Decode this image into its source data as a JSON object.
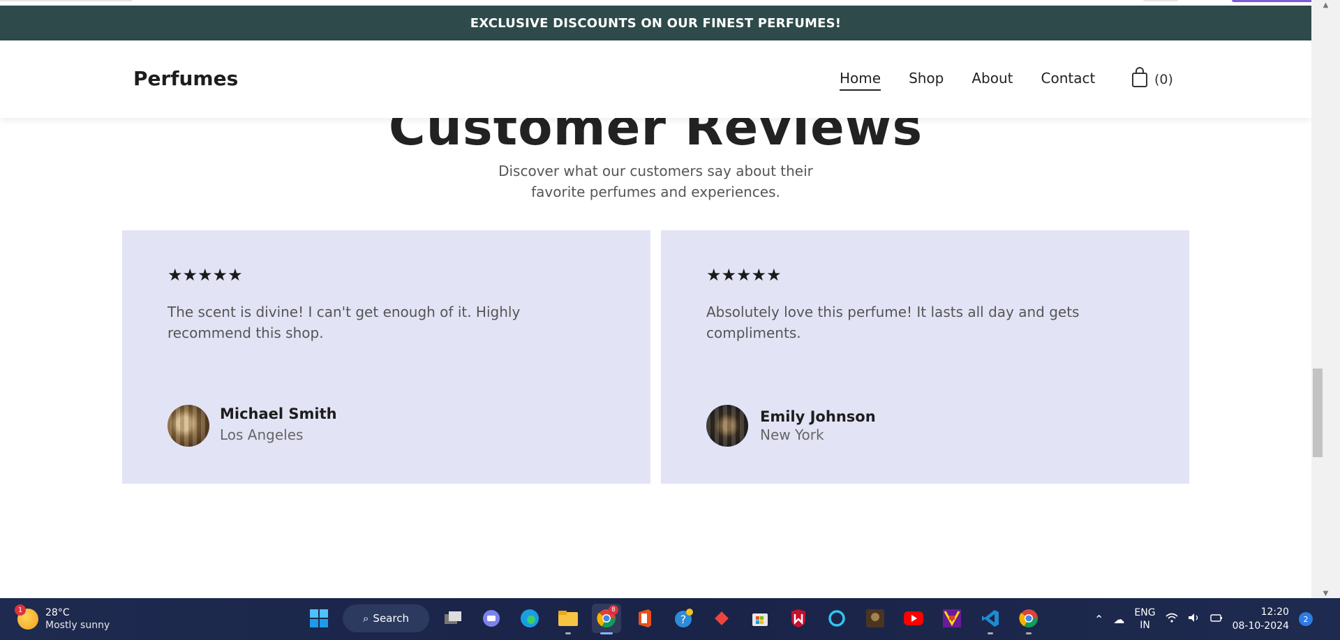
{
  "promo": {
    "text": "EXCLUSIVE DISCOUNTS ON OUR FINEST PERFUMES!"
  },
  "header": {
    "brand": "Perfumes",
    "nav": [
      "Home",
      "Shop",
      "About",
      "Contact"
    ],
    "cart_count": "(0)"
  },
  "section": {
    "title": "Customer Reviews",
    "subtitle_line1": "Discover what our customers say about their",
    "subtitle_line2": "favorite perfumes and experiences."
  },
  "reviews": [
    {
      "rating": "★★★★★",
      "text": "The scent is divine! I can't get enough of it. Highly recommend this shop.",
      "name": "Michael Smith",
      "city": "Los Angeles"
    },
    {
      "rating": "★★★★★",
      "text": "Absolutely love this perfume! It lasts all day and gets compliments.",
      "name": "Emily Johnson",
      "city": "New York"
    }
  ],
  "taskbar": {
    "weather_badge": "1",
    "temperature": "28°C",
    "weather_desc": "Mostly sunny",
    "search_label": "Search",
    "chrome_badge": "8",
    "lang_top": "ENG",
    "lang_bottom": "IN",
    "time": "12:20",
    "date": "08-10-2024",
    "notifications": "2"
  },
  "colors": {
    "promo_bg": "#2e4a4a",
    "card_bg": "#e3e3f6",
    "taskbar_bg": "#1a2348"
  }
}
